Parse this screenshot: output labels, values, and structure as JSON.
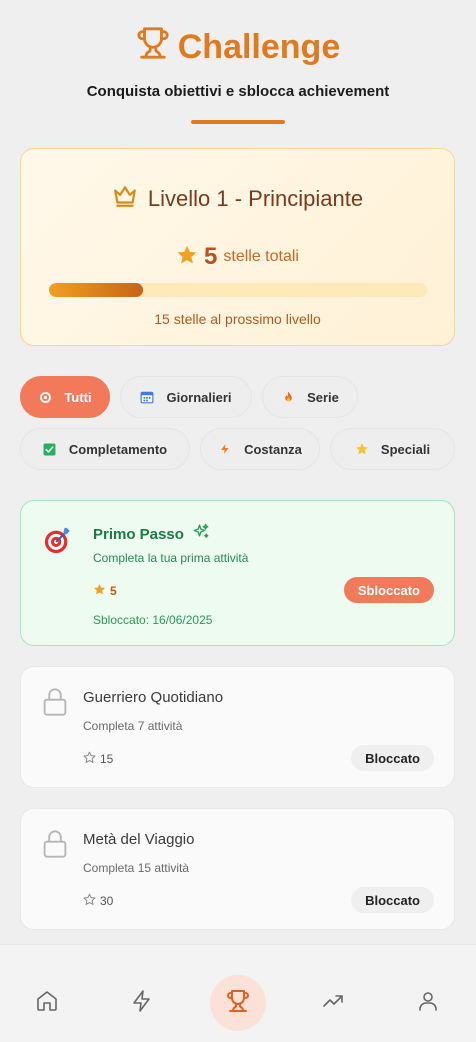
{
  "header": {
    "title": "Challenge",
    "subtitle": "Conquista obiettivi e sblocca achievement"
  },
  "level": {
    "title": "Livello 1 - Principiante",
    "stars_total": "5",
    "stars_label": "stelle totali",
    "progress_fraction": 0.25,
    "progress_text": "15 stelle al prossimo livello"
  },
  "filters": [
    {
      "label": "Tutti",
      "icon": "target-icon"
    },
    {
      "label": "Giornalieri",
      "icon": "calendar-icon"
    },
    {
      "label": "Serie",
      "icon": "fire-icon"
    },
    {
      "label": "Completamento",
      "icon": "check-icon"
    },
    {
      "label": "Costanza",
      "icon": "bolt-icon"
    },
    {
      "label": "Speciali",
      "icon": "star-icon"
    }
  ],
  "achievements": [
    {
      "name": "Primo Passo",
      "desc": "Completa la tua prima attività",
      "stars": "5",
      "status": "Sbloccato",
      "unlocked_date": "Sbloccato: 16/06/2025"
    },
    {
      "name": "Guerriero Quotidiano",
      "desc": "Completa 7 attività",
      "stars": "15",
      "status": "Bloccato"
    },
    {
      "name": "Metà del Viaggio",
      "desc": "Completa 15 attività",
      "stars": "30",
      "status": "Bloccato"
    }
  ],
  "nav": [
    "home-icon",
    "bolt-icon",
    "trophy-icon",
    "trending-icon",
    "user-icon"
  ],
  "colors": {
    "accent": "#e07a1e",
    "active_chip": "#f27a5a",
    "unlocked_card": "#edfbf1"
  }
}
